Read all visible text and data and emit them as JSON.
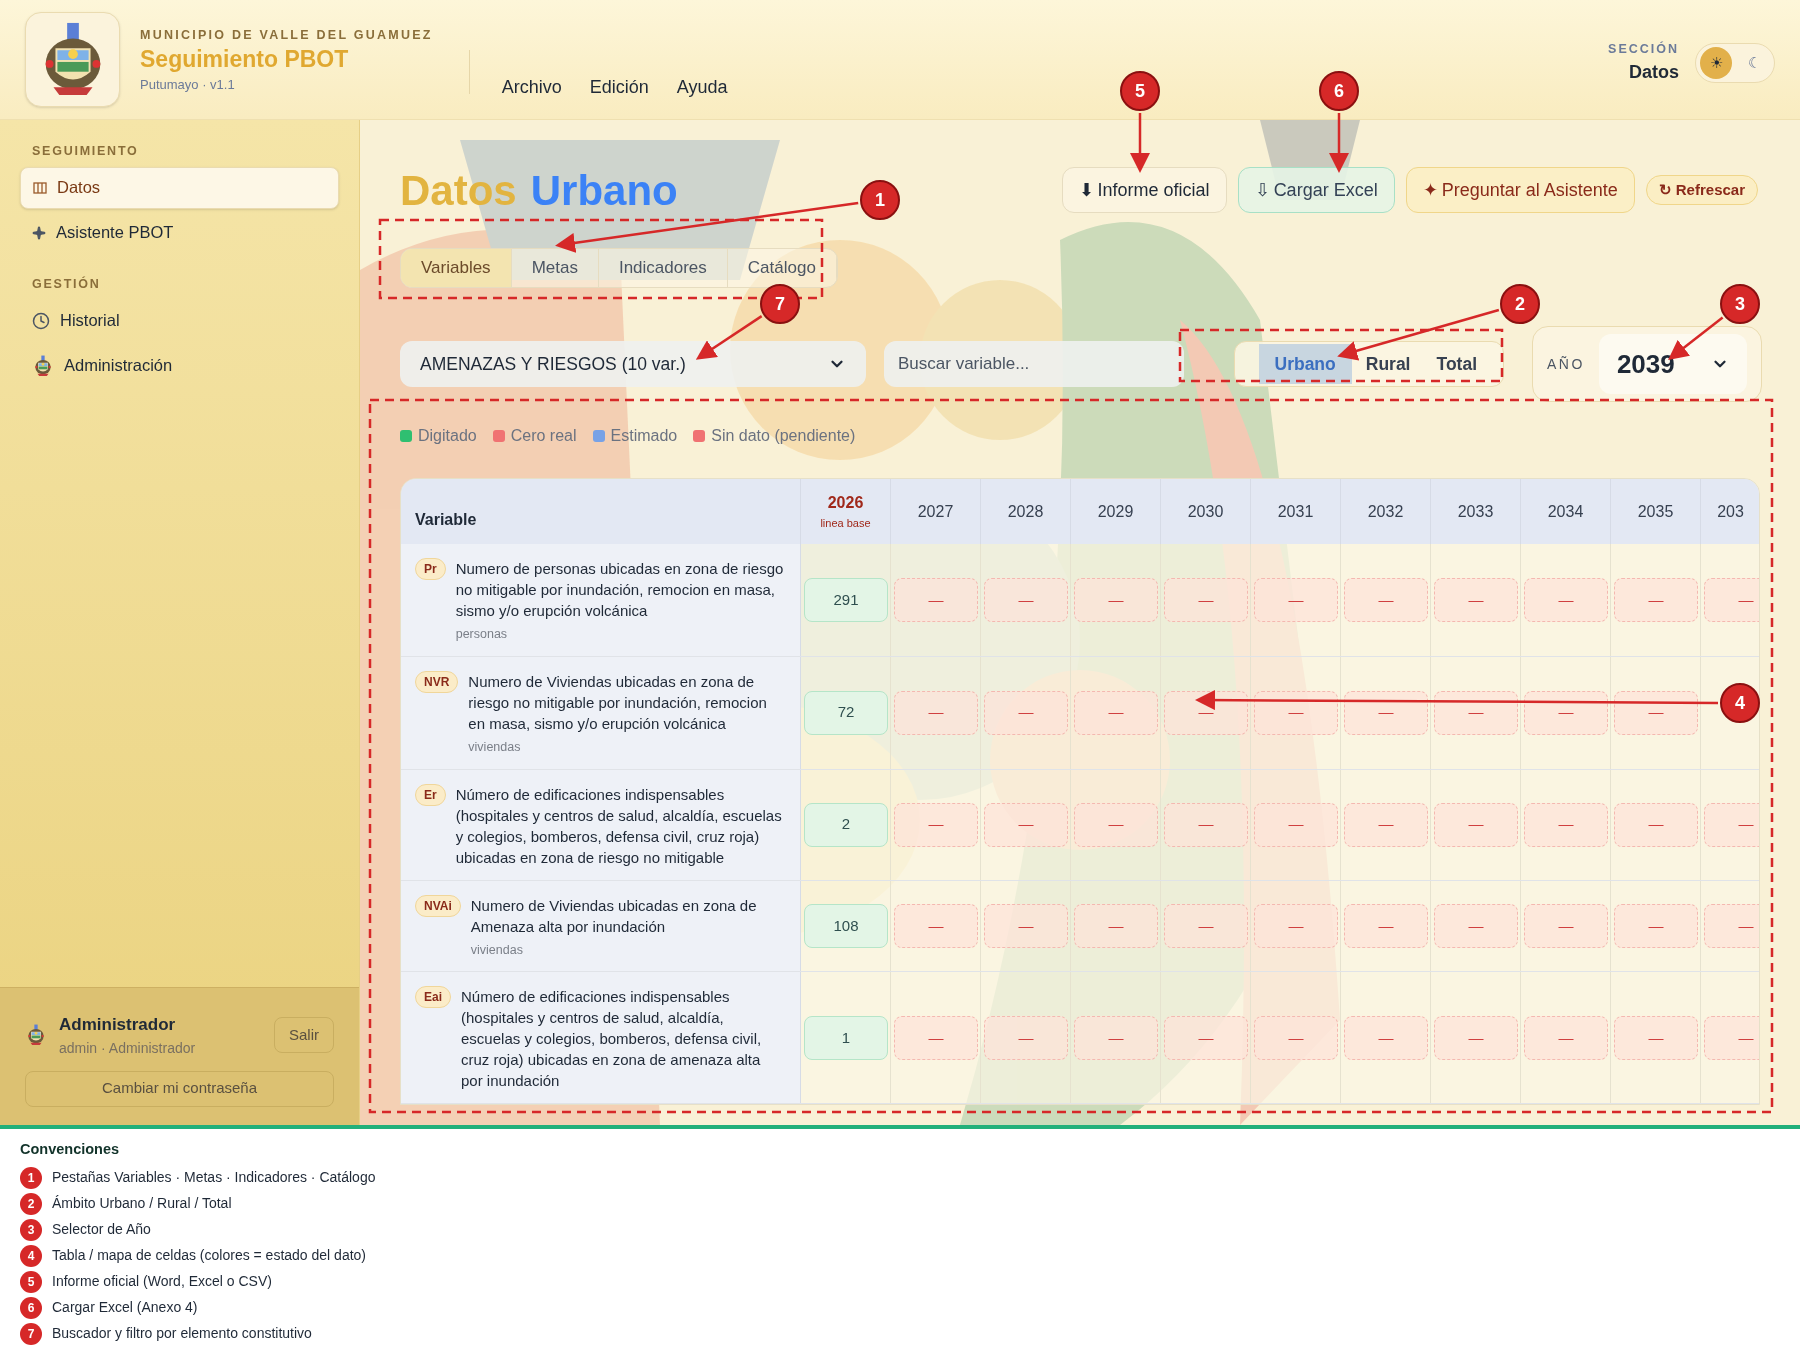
{
  "header": {
    "org": "MUNICIPIO DE VALLE DEL GUAMUEZ",
    "app_title": "Seguimiento PBOT",
    "subtitle": "Putumayo · v1.1",
    "menu": [
      "Archivo",
      "Edición",
      "Ayuda"
    ],
    "section_label": "SECCIÓN",
    "section": "Datos",
    "theme": [
      {
        "glyph": "☀",
        "selected": true
      },
      {
        "glyph": "☾",
        "selected": false
      }
    ]
  },
  "sidebar": {
    "groups": [
      {
        "title": "SEGUIMIENTO",
        "items": [
          {
            "label": "Datos",
            "selected": true
          },
          {
            "label": "Asistente PBOT",
            "selected": false
          }
        ]
      },
      {
        "title": "GESTIÓN",
        "items": [
          {
            "label": "Historial",
            "selected": false
          },
          {
            "label": "Administración",
            "selected": false
          }
        ]
      }
    ],
    "user": {
      "name": "Administrador",
      "role": "admin · Administrador",
      "logout": "Salir",
      "change_password": "Cambiar mi contraseña"
    }
  },
  "page": {
    "title": "Datos",
    "scope_title": "Urbano",
    "actions": [
      {
        "kind": "plain",
        "icon": "⬇",
        "label": "Informe oficial"
      },
      {
        "kind": "green",
        "icon": "⇩",
        "label": "Cargar Excel"
      },
      {
        "kind": "amber",
        "icon": "✦",
        "label": "Preguntar al Asistente"
      },
      {
        "kind": "small",
        "icon": "↻",
        "label": "Refrescar"
      }
    ],
    "tabs": [
      {
        "label": "Variables",
        "selected": true
      },
      {
        "label": "Metas",
        "selected": false
      },
      {
        "label": "Indicadores",
        "selected": false
      },
      {
        "label": "Catálogo",
        "selected": false
      }
    ],
    "filters": {
      "group": "AMENAZAS Y RIESGOS (10 var.)",
      "search_placeholder": "Buscar variable...",
      "scopes": [
        {
          "label": "Urbano",
          "selected": true
        },
        {
          "label": "Rural",
          "selected": false
        },
        {
          "label": "Total",
          "selected": false
        }
      ],
      "year_label": "AÑO",
      "year": "2039"
    },
    "legend": [
      {
        "label": "Digitado",
        "color": "#2fbf71"
      },
      {
        "label": "Cero real",
        "color": "#f07272"
      },
      {
        "label": "Estimado",
        "color": "#78a2e6"
      },
      {
        "label": "Sin dato (pendiente)",
        "color": "#f07272"
      }
    ],
    "table": {
      "variable_header": "Variable",
      "years": [
        {
          "label": "2026",
          "note": "linea base",
          "baseline": true
        },
        {
          "label": "2027",
          "baseline": false
        },
        {
          "label": "2028",
          "baseline": false
        },
        {
          "label": "2029",
          "baseline": false
        },
        {
          "label": "2030",
          "baseline": false
        },
        {
          "label": "2031",
          "baseline": false
        },
        {
          "label": "2032",
          "baseline": false
        },
        {
          "label": "2033",
          "baseline": false
        },
        {
          "label": "2034",
          "baseline": false
        },
        {
          "label": "2035",
          "baseline": false
        },
        {
          "label": "203",
          "baseline": false
        }
      ],
      "rows": [
        {
          "code": "Pr",
          "name": "Numero de personas ubicadas en zona de riesgo no mitigable por inundación, remocion en masa, sismo y/o erupción volcánica",
          "unit": "personas",
          "cells": [
            {
              "text": "291",
              "kind": "digitado"
            },
            {
              "text": "—",
              "kind": "pendiente"
            },
            {
              "text": "—",
              "kind": "pendiente"
            },
            {
              "text": "—",
              "kind": "pendiente"
            },
            {
              "text": "—",
              "kind": "pendiente"
            },
            {
              "text": "—",
              "kind": "pendiente"
            },
            {
              "text": "—",
              "kind": "pendiente"
            },
            {
              "text": "—",
              "kind": "pendiente"
            },
            {
              "text": "—",
              "kind": "pendiente"
            },
            {
              "text": "—",
              "kind": "pendiente"
            },
            {
              "text": "—",
              "kind": "pendiente"
            }
          ]
        },
        {
          "code": "NVR",
          "name": "Numero de Viviendas ubicadas en zona de riesgo no mitigable por inundación, remocion en masa, sismo y/o erupción volcánica",
          "unit": "viviendas",
          "cells": [
            {
              "text": "72",
              "kind": "digitado"
            },
            {
              "text": "—",
              "kind": "pendiente"
            },
            {
              "text": "—",
              "kind": "pendiente"
            },
            {
              "text": "—",
              "kind": "pendiente"
            },
            {
              "text": "—",
              "kind": "pendiente"
            },
            {
              "text": "—",
              "kind": "pendiente"
            },
            {
              "text": "—",
              "kind": "pendiente"
            },
            {
              "text": "—",
              "kind": "pendiente"
            },
            {
              "text": "—",
              "kind": "pendiente"
            },
            {
              "text": "—",
              "kind": "pendiente"
            }
          ]
        },
        {
          "code": "Er",
          "name": "Número de edificaciones indispensables (hospitales y centros de salud, alcaldía, escuelas y colegios, bomberos, defensa civil, cruz roja) ubicadas en zona de riesgo no mitigable",
          "cells": [
            {
              "text": "2",
              "kind": "digitado"
            },
            {
              "text": "—",
              "kind": "pendiente"
            },
            {
              "text": "—",
              "kind": "pendiente"
            },
            {
              "text": "—",
              "kind": "pendiente"
            },
            {
              "text": "—",
              "kind": "pendiente"
            },
            {
              "text": "—",
              "kind": "pendiente"
            },
            {
              "text": "—",
              "kind": "pendiente"
            },
            {
              "text": "—",
              "kind": "pendiente"
            },
            {
              "text": "—",
              "kind": "pendiente"
            },
            {
              "text": "—",
              "kind": "pendiente"
            },
            {
              "text": "—",
              "kind": "pendiente"
            }
          ]
        },
        {
          "code": "NVAi",
          "name": "Numero de Viviendas ubicadas en zona de Amenaza alta por inundación",
          "unit": "viviendas",
          "cells": [
            {
              "text": "108",
              "kind": "digitado"
            },
            {
              "text": "—",
              "kind": "pendiente"
            },
            {
              "text": "—",
              "kind": "pendiente"
            },
            {
              "text": "—",
              "kind": "pendiente"
            },
            {
              "text": "—",
              "kind": "pendiente"
            },
            {
              "text": "—",
              "kind": "pendiente"
            },
            {
              "text": "—",
              "kind": "pendiente"
            },
            {
              "text": "—",
              "kind": "pendiente"
            },
            {
              "text": "—",
              "kind": "pendiente"
            },
            {
              "text": "—",
              "kind": "pendiente"
            },
            {
              "text": "—",
              "kind": "pendiente"
            }
          ]
        },
        {
          "code": "Eai",
          "name": "Número de edificaciones indispensables (hospitales y centros de salud, alcaldía, escuelas y colegios, bomberos, defensa civil, cruz roja) ubicadas en zona de amenaza alta por inundación",
          "cells": [
            {
              "text": "1",
              "kind": "digitado"
            },
            {
              "text": "—",
              "kind": "pendiente"
            },
            {
              "text": "—",
              "kind": "pendiente"
            },
            {
              "text": "—",
              "kind": "pendiente"
            },
            {
              "text": "—",
              "kind": "pendiente"
            },
            {
              "text": "—",
              "kind": "pendiente"
            },
            {
              "text": "—",
              "kind": "pendiente"
            },
            {
              "text": "—",
              "kind": "pendiente"
            },
            {
              "text": "—",
              "kind": "pendiente"
            },
            {
              "text": "—",
              "kind": "pendiente"
            },
            {
              "text": "—",
              "kind": "pendiente"
            }
          ]
        }
      ]
    }
  },
  "annotations": {
    "markers": [
      "1",
      "2",
      "3",
      "4",
      "5",
      "6",
      "7"
    ],
    "conventions_title": "Convenciones",
    "conventions": [
      {
        "number": "1",
        "text": "Pestañas Variables · Metas · Indicadores · Catálogo"
      },
      {
        "number": "2",
        "text": "Ámbito Urbano / Rural / Total"
      },
      {
        "number": "3",
        "text": "Selector de Año"
      },
      {
        "number": "4",
        "text": "Tabla / mapa de celdas (colores = estado del dato)"
      },
      {
        "number": "5",
        "text": "Informe oficial (Word, Excel o CSV)"
      },
      {
        "number": "6",
        "text": "Cargar Excel (Anexo 4)"
      },
      {
        "number": "7",
        "text": "Buscador y filtro por elemento constitutivo"
      }
    ]
  }
}
